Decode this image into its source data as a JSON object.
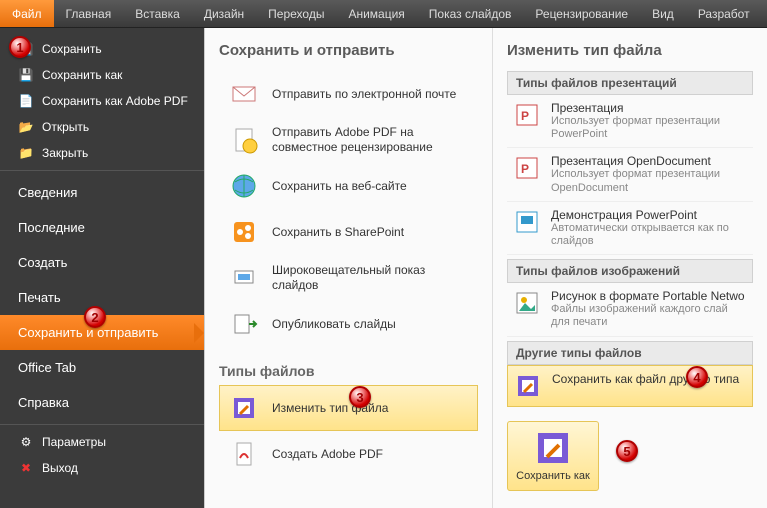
{
  "ribbon": {
    "tabs": [
      "Файл",
      "Главная",
      "Вставка",
      "Дизайн",
      "Переходы",
      "Анимация",
      "Показ слайдов",
      "Рецензирование",
      "Вид",
      "Разработ"
    ]
  },
  "sidebar": {
    "items": [
      {
        "label": "Сохранить",
        "icon": "save"
      },
      {
        "label": "Сохранить как",
        "icon": "save-as"
      },
      {
        "label": "Сохранить как Adobe PDF",
        "icon": "pdf"
      },
      {
        "label": "Открыть",
        "icon": "folder"
      },
      {
        "label": "Закрыть",
        "icon": "folder-close"
      }
    ],
    "big_items": [
      {
        "label": "Сведения"
      },
      {
        "label": "Последние"
      },
      {
        "label": "Создать"
      },
      {
        "label": "Печать"
      },
      {
        "label": "Сохранить и отправить",
        "active": true
      },
      {
        "label": "Office Tab"
      },
      {
        "label": "Справка"
      }
    ],
    "bottom": [
      {
        "label": "Параметры",
        "icon": "options"
      },
      {
        "label": "Выход",
        "icon": "exit"
      }
    ]
  },
  "left_panel": {
    "title": "Сохранить и отправить",
    "items": [
      {
        "label": "Отправить по электронной почте",
        "icon": "mail"
      },
      {
        "label": "Отправить Adobe PDF на совместное рецензирование",
        "icon": "pdf-review"
      },
      {
        "label": "Сохранить на веб-сайте",
        "icon": "globe"
      },
      {
        "label": "Сохранить в SharePoint",
        "icon": "sharepoint"
      },
      {
        "label": "Широковещательный показ слайдов",
        "icon": "broadcast"
      },
      {
        "label": "Опубликовать слайды",
        "icon": "publish"
      }
    ],
    "types_title": "Типы файлов",
    "type_items": [
      {
        "label": "Изменить тип файла",
        "icon": "change-type",
        "selected": true
      },
      {
        "label": "Создать Adobe PDF",
        "icon": "create-pdf"
      }
    ]
  },
  "right_panel": {
    "title": "Изменить тип файла",
    "cat1": "Типы файлов презентаций",
    "files1": [
      {
        "title": "Презентация",
        "desc": "Использует формат презентации PowerPoint",
        "icon": "pptx"
      },
      {
        "title": "Презентация OpenDocument",
        "desc": "Использует формат презентации OpenDocument",
        "icon": "odp"
      },
      {
        "title": "Демонстрация PowerPoint",
        "desc": "Автоматически открывается как по слайдов",
        "icon": "ppsx"
      }
    ],
    "cat2": "Типы файлов изображений",
    "files2": [
      {
        "title": "Рисунок в формате Portable Netwo",
        "desc": "Файлы изображений каждого слай для печати",
        "icon": "png"
      }
    ],
    "cat3": "Другие типы файлов",
    "files3": [
      {
        "title": "Сохранить как файл другого типа",
        "desc": "",
        "icon": "save-other",
        "selected": true
      }
    ],
    "save_button": "Сохранить как"
  },
  "callouts": {
    "1": "1",
    "2": "2",
    "3": "3",
    "4": "4",
    "5": "5"
  }
}
